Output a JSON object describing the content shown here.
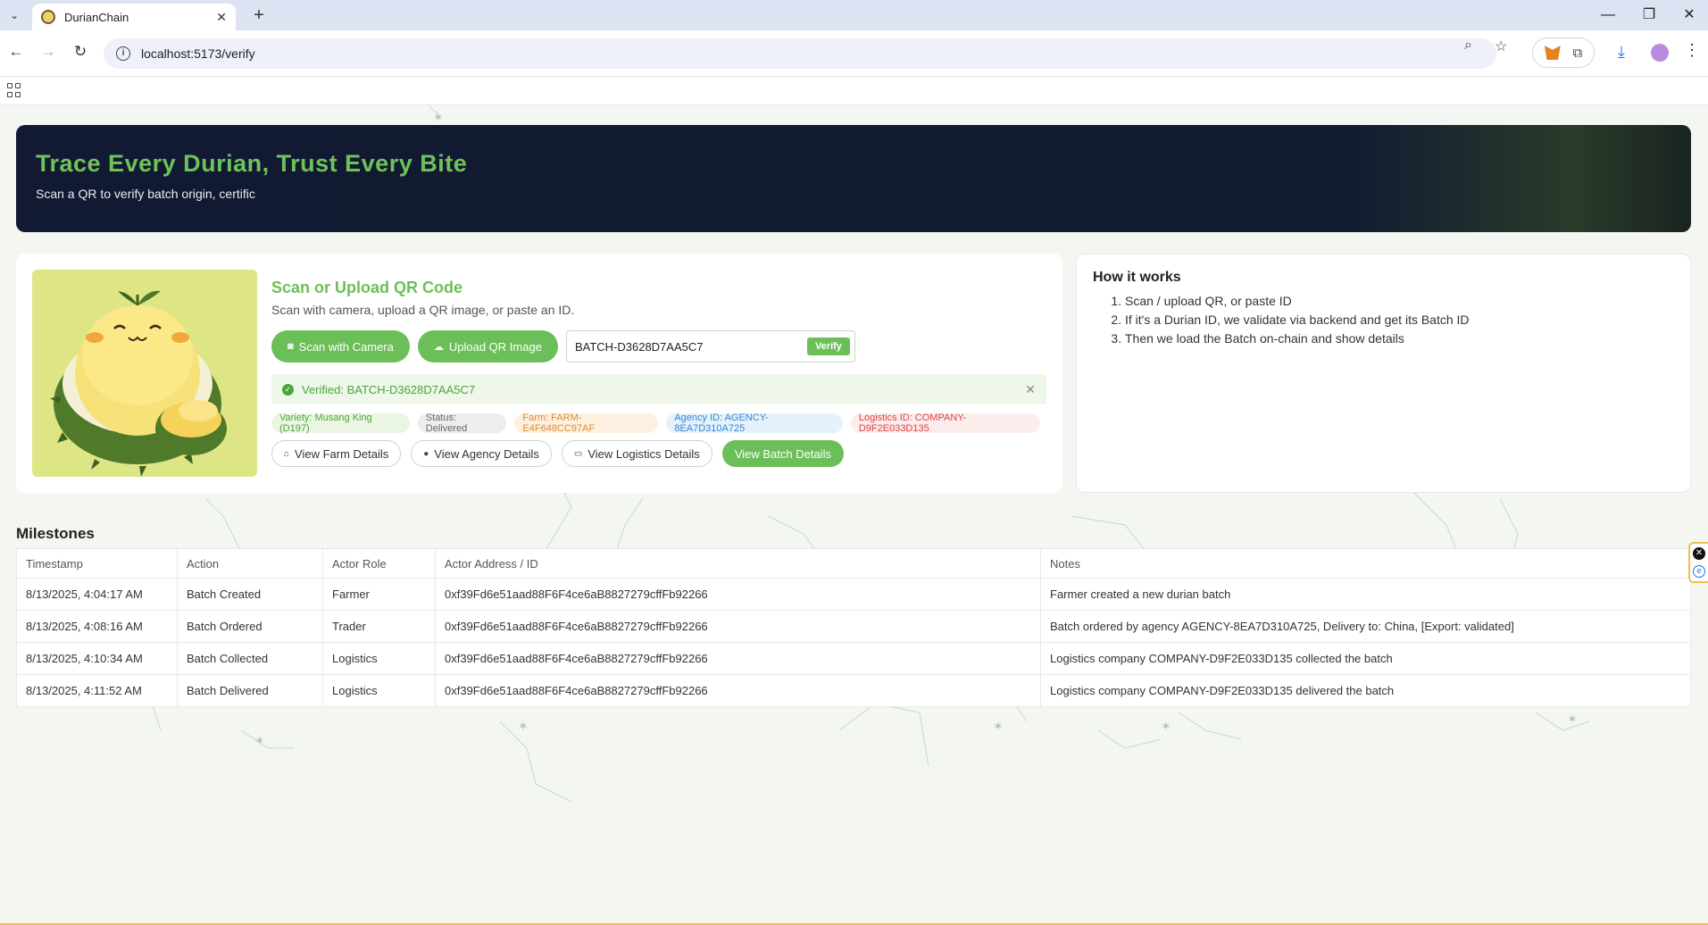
{
  "browser": {
    "tab_title": "DurianChain",
    "url": "localhost:5173/verify",
    "tab_close": "✕",
    "new_tab": "+",
    "minimize": "—",
    "restore": "❐",
    "close": "✕"
  },
  "hero": {
    "title": "Trace Every Durian, Trust Every Bite",
    "subtitle": "Scan a QR to verify batch origin, certific"
  },
  "scan": {
    "title": "Scan or Upload QR Code",
    "subtitle": "Scan with camera, upload a QR image, or paste an ID.",
    "camera_button": "Scan with Camera",
    "upload_button": "Upload QR Image",
    "id_value": "BATCH-D3628D7AA5C7",
    "verify_button": "Verify",
    "verified_text": "Verified: BATCH-D3628D7AA5C7",
    "chips": {
      "variety": "Variety: Musang King (D197)",
      "status": "Status: Delivered",
      "farm": "Farm: FARM-E4F648CC97AF",
      "agency": "Agency ID: AGENCY-8EA7D310A725",
      "logistics": "Logistics ID: COMPANY-D9F2E033D135"
    },
    "links": {
      "farm": "View Farm Details",
      "agency": "View Agency Details",
      "logistics": "View Logistics Details",
      "batch": "View Batch Details"
    }
  },
  "how": {
    "title": "How it works",
    "steps": [
      "Scan / upload QR, or paste ID",
      "If it's a Durian ID, we validate via backend and get its Batch ID",
      "Then we load the Batch on-chain and show details"
    ]
  },
  "milestones": {
    "title": "Milestones",
    "headers": [
      "Timestamp",
      "Action",
      "Actor Role",
      "Actor Address / ID",
      "Notes"
    ],
    "rows": [
      [
        "8/13/2025, 4:04:17 AM",
        "Batch Created",
        "Farmer",
        "0xf39Fd6e51aad88F6F4ce6aB8827279cffFb92266",
        "Farmer created a new durian batch"
      ],
      [
        "8/13/2025, 4:08:16 AM",
        "Batch Ordered",
        "Trader",
        "0xf39Fd6e51aad88F6F4ce6aB8827279cffFb92266",
        "Batch ordered by agency AGENCY-8EA7D310A725, Delivery to: China, [Export: validated]"
      ],
      [
        "8/13/2025, 4:10:34 AM",
        "Batch Collected",
        "Logistics",
        "0xf39Fd6e51aad88F6F4ce6aB8827279cffFb92266",
        "Logistics company COMPANY-D9F2E033D135 collected the batch"
      ],
      [
        "8/13/2025, 4:11:52 AM",
        "Batch Delivered",
        "Logistics",
        "0xf39Fd6e51aad88F6F4ce6aB8827279cffFb92266",
        "Logistics company COMPANY-D9F2E033D135 delivered the batch"
      ]
    ]
  },
  "colors": {
    "accent": "#6cbf58",
    "hero_bg": "#121a33",
    "verified_bg": "#eef7e9"
  }
}
